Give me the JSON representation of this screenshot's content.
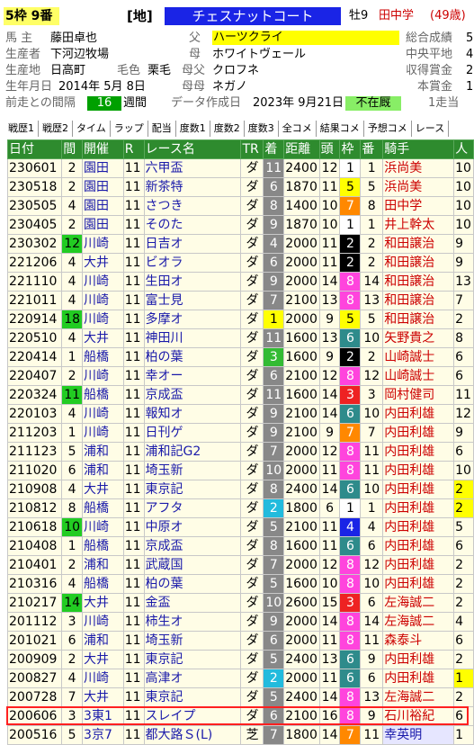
{
  "header": {
    "waku_badge": "5枠 9番",
    "course": "[地]",
    "horse_name": "チェスナットコート",
    "sex_age": "牡9",
    "trainer": "田中学",
    "trainer_age": "(49歳)",
    "rows": [
      {
        "l1": "馬 主",
        "v1": "藤田卓也",
        "l2": "父",
        "v2": "ハーツクライ",
        "l3": "総合成績",
        "v3": "5"
      },
      {
        "l1": "生産者",
        "v1": "下河辺牧場",
        "l2": "母",
        "v2": "ホワイトヴェール",
        "l3": "中央平地",
        "v3": "4"
      },
      {
        "l1": "生産地",
        "v1": "日高町",
        "l1b": "毛色",
        "v1b": "栗毛",
        "l2": "母父",
        "v2": "クロフネ",
        "l3": "収得賞金",
        "v3": "2"
      },
      {
        "l1": "生年月日",
        "v1": "2014年 5月 8日",
        "l2": "母母",
        "v2": "ネガノ",
        "l3": "本賞金",
        "v3": "1"
      },
      {
        "l1": "前走との間隔",
        "v1": "16",
        "v1u": "週間",
        "l2": "データ作成日",
        "v2": "2023年 9月21日",
        "v2b": "不在厩",
        "l3": "1走当",
        "v3": ""
      }
    ]
  },
  "tabs": [
    "戦歴1",
    "戦歴2",
    "タイム",
    "ラップ",
    "配当",
    "度数1",
    "度数2",
    "度数3",
    "全コメ",
    "結果コメ",
    "予想コメ",
    "レース"
  ],
  "colors": {
    "header_green": "#2e8b2e",
    "row_bg": "#fffde6",
    "jockey_red": "#cc0000",
    "link_blue": "#1a1aaa",
    "highlight_frame": "#ff2020"
  },
  "table": {
    "headers": [
      "日付",
      "間",
      "開催",
      "R",
      "レース名",
      "TR",
      "着",
      "距離",
      "頭",
      "枠",
      "番",
      "騎手",
      "人"
    ],
    "rows": [
      {
        "date": "230601",
        "int": "2",
        "int_color": "",
        "place": "園田",
        "r": "11",
        "race": "六甲盃",
        "tr": "ダ",
        "cha": "11",
        "cha_bg": "#888888",
        "dist": "2400",
        "n": "12",
        "waku": "1",
        "waku_bg": "#ffffff",
        "waku_fg": "#000",
        "ban": "1",
        "jockey": "浜尚美",
        "jblue": false,
        "ninki": "10",
        "ninki_bg": ""
      },
      {
        "date": "230518",
        "int": "2",
        "int_color": "",
        "place": "園田",
        "r": "11",
        "race": "新茶特",
        "tr": "ダ",
        "cha": "6",
        "cha_bg": "#888888",
        "dist": "1870",
        "n": "11",
        "waku": "5",
        "waku_bg": "#ffff00",
        "waku_fg": "#000",
        "ban": "5",
        "jockey": "浜尚美",
        "jblue": false,
        "ninki": "10",
        "ninki_bg": ""
      },
      {
        "date": "230505",
        "int": "4",
        "int_color": "",
        "place": "園田",
        "r": "11",
        "race": "さつき",
        "tr": "ダ",
        "cha": "8",
        "cha_bg": "#888888",
        "dist": "1400",
        "n": "10",
        "waku": "7",
        "waku_bg": "#ff8800",
        "waku_fg": "#fff",
        "ban": "8",
        "jockey": "田中学",
        "jblue": false,
        "ninki": "10",
        "ninki_bg": ""
      },
      {
        "date": "230405",
        "int": "2",
        "int_color": "",
        "place": "園田",
        "r": "11",
        "race": "そのた",
        "tr": "ダ",
        "cha": "9",
        "cha_bg": "#888888",
        "dist": "1870",
        "n": "10",
        "waku": "1",
        "waku_bg": "#ffffff",
        "waku_fg": "#000",
        "ban": "1",
        "jockey": "井上幹太",
        "jblue": false,
        "ninki": "10",
        "ninki_bg": ""
      },
      {
        "date": "230302",
        "int": "12",
        "int_color": "#22cc22",
        "place": "川崎",
        "r": "11",
        "race": "日吉オ",
        "tr": "ダ",
        "cha": "4",
        "cha_bg": "#888888",
        "dist": "2000",
        "n": "11",
        "waku": "2",
        "waku_bg": "#000000",
        "waku_fg": "#fff",
        "ban": "2",
        "jockey": "和田譲治",
        "jblue": false,
        "ninki": "9",
        "ninki_bg": ""
      },
      {
        "date": "221206",
        "int": "4",
        "int_color": "",
        "place": "大井",
        "r": "11",
        "race": "ビオラ",
        "tr": "ダ",
        "cha": "6",
        "cha_bg": "#888888",
        "dist": "2000",
        "n": "11",
        "waku": "2",
        "waku_bg": "#000000",
        "waku_fg": "#fff",
        "ban": "2",
        "jockey": "和田譲治",
        "jblue": false,
        "ninki": "9",
        "ninki_bg": ""
      },
      {
        "date": "221110",
        "int": "4",
        "int_color": "",
        "place": "川崎",
        "r": "11",
        "race": "生田オ",
        "tr": "ダ",
        "cha": "9",
        "cha_bg": "#888888",
        "dist": "2000",
        "n": "14",
        "waku": "8",
        "waku_bg": "#ff44dd",
        "waku_fg": "#fff",
        "ban": "14",
        "jockey": "和田譲治",
        "jblue": false,
        "ninki": "13",
        "ninki_bg": ""
      },
      {
        "date": "221011",
        "int": "4",
        "int_color": "",
        "place": "川崎",
        "r": "11",
        "race": "富士見",
        "tr": "ダ",
        "cha": "7",
        "cha_bg": "#888888",
        "dist": "2100",
        "n": "13",
        "waku": "8",
        "waku_bg": "#ff44dd",
        "waku_fg": "#fff",
        "ban": "13",
        "jockey": "和田譲治",
        "jblue": false,
        "ninki": "7",
        "ninki_bg": ""
      },
      {
        "date": "220914",
        "int": "18",
        "int_color": "#22cc22",
        "place": "川崎",
        "r": "11",
        "race": "多摩オ",
        "tr": "ダ",
        "cha": "1",
        "cha_bg": "#ffff00",
        "dist": "2000",
        "n": "9",
        "waku": "5",
        "waku_bg": "#ffff00",
        "waku_fg": "#000",
        "ban": "5",
        "jockey": "和田譲治",
        "jblue": false,
        "ninki": "2",
        "ninki_bg": ""
      },
      {
        "date": "220510",
        "int": "4",
        "int_color": "",
        "place": "大井",
        "r": "11",
        "race": "神田川",
        "tr": "ダ",
        "cha": "11",
        "cha_bg": "#888888",
        "dist": "1600",
        "n": "13",
        "waku": "6",
        "waku_bg": "#2e8b8b",
        "waku_fg": "#fff",
        "ban": "10",
        "jockey": "矢野貴之",
        "jblue": false,
        "ninki": "8",
        "ninki_bg": ""
      },
      {
        "date": "220414",
        "int": "1",
        "int_color": "",
        "place": "船橋",
        "r": "11",
        "race": "柏の葉",
        "tr": "ダ",
        "cha": "3",
        "cha_bg": "#33bb33",
        "dist": "1600",
        "n": "9",
        "waku": "2",
        "waku_bg": "#000000",
        "waku_fg": "#fff",
        "ban": "2",
        "jockey": "山崎誠士",
        "jblue": false,
        "ninki": "6",
        "ninki_bg": ""
      },
      {
        "date": "220407",
        "int": "2",
        "int_color": "",
        "place": "川崎",
        "r": "11",
        "race": "幸オー",
        "tr": "ダ",
        "cha": "6",
        "cha_bg": "#888888",
        "dist": "2100",
        "n": "12",
        "waku": "8",
        "waku_bg": "#ff44dd",
        "waku_fg": "#fff",
        "ban": "12",
        "jockey": "山崎誠士",
        "jblue": false,
        "ninki": "6",
        "ninki_bg": ""
      },
      {
        "date": "220324",
        "int": "11",
        "int_color": "#22cc22",
        "place": "船橋",
        "r": "11",
        "race": "京成盃",
        "tr": "ダ",
        "cha": "11",
        "cha_bg": "#888888",
        "dist": "1600",
        "n": "14",
        "waku": "3",
        "waku_bg": "#ee2222",
        "waku_fg": "#fff",
        "ban": "3",
        "jockey": "岡村健司",
        "jblue": false,
        "ninki": "11",
        "ninki_bg": ""
      },
      {
        "date": "220103",
        "int": "4",
        "int_color": "",
        "place": "川崎",
        "r": "11",
        "race": "報知オ",
        "tr": "ダ",
        "cha": "9",
        "cha_bg": "#888888",
        "dist": "2100",
        "n": "14",
        "waku": "6",
        "waku_bg": "#2e8b8b",
        "waku_fg": "#fff",
        "ban": "10",
        "jockey": "内田利雄",
        "jblue": false,
        "ninki": "12",
        "ninki_bg": ""
      },
      {
        "date": "211203",
        "int": "1",
        "int_color": "",
        "place": "川崎",
        "r": "11",
        "race": "日刊ゲ",
        "tr": "ダ",
        "cha": "9",
        "cha_bg": "#888888",
        "dist": "2100",
        "n": "9",
        "waku": "7",
        "waku_bg": "#ff8800",
        "waku_fg": "#fff",
        "ban": "7",
        "jockey": "内田利雄",
        "jblue": false,
        "ninki": "9",
        "ninki_bg": ""
      },
      {
        "date": "211123",
        "int": "5",
        "int_color": "",
        "place": "浦和",
        "r": "11",
        "race": "浦和記G2",
        "tr": "ダ",
        "cha": "7",
        "cha_bg": "#888888",
        "dist": "2000",
        "n": "12",
        "waku": "8",
        "waku_bg": "#ff44dd",
        "waku_fg": "#fff",
        "ban": "11",
        "jockey": "内田利雄",
        "jblue": false,
        "ninki": "6",
        "ninki_bg": ""
      },
      {
        "date": "211020",
        "int": "6",
        "int_color": "",
        "place": "浦和",
        "r": "11",
        "race": "埼玉新",
        "tr": "ダ",
        "cha": "10",
        "cha_bg": "#888888",
        "dist": "2000",
        "n": "11",
        "waku": "8",
        "waku_bg": "#ff44dd",
        "waku_fg": "#fff",
        "ban": "11",
        "jockey": "内田利雄",
        "jblue": false,
        "ninki": "10",
        "ninki_bg": ""
      },
      {
        "date": "210908",
        "int": "4",
        "int_color": "",
        "place": "大井",
        "r": "11",
        "race": "東京記",
        "tr": "ダ",
        "cha": "8",
        "cha_bg": "#888888",
        "dist": "2400",
        "n": "14",
        "waku": "6",
        "waku_bg": "#2e8b8b",
        "waku_fg": "#fff",
        "ban": "10",
        "jockey": "内田利雄",
        "jblue": false,
        "ninki": "2",
        "ninki_bg": "#ffff00"
      },
      {
        "date": "210812",
        "int": "8",
        "int_color": "",
        "place": "船橋",
        "r": "11",
        "race": "アフタ",
        "tr": "ダ",
        "cha": "2",
        "cha_bg": "#22bbdd",
        "dist": "1800",
        "n": "6",
        "waku": "1",
        "waku_bg": "#ffffff",
        "waku_fg": "#000",
        "ban": "1",
        "jockey": "内田利雄",
        "jblue": false,
        "ninki": "2",
        "ninki_bg": "#ffff00"
      },
      {
        "date": "210618",
        "int": "10",
        "int_color": "#22cc22",
        "place": "川崎",
        "r": "11",
        "race": "中原オ",
        "tr": "ダ",
        "cha": "5",
        "cha_bg": "#888888",
        "dist": "2100",
        "n": "11",
        "waku": "4",
        "waku_bg": "#1a24e6",
        "waku_fg": "#fff",
        "ban": "4",
        "jockey": "内田利雄",
        "jblue": false,
        "ninki": "5",
        "ninki_bg": ""
      },
      {
        "date": "210408",
        "int": "1",
        "int_color": "",
        "place": "船橋",
        "r": "11",
        "race": "京成盃",
        "tr": "ダ",
        "cha": "8",
        "cha_bg": "#888888",
        "dist": "1600",
        "n": "11",
        "waku": "6",
        "waku_bg": "#2e8b8b",
        "waku_fg": "#fff",
        "ban": "6",
        "jockey": "内田利雄",
        "jblue": false,
        "ninki": "6",
        "ninki_bg": ""
      },
      {
        "date": "210401",
        "int": "2",
        "int_color": "",
        "place": "浦和",
        "r": "11",
        "race": "武蔵国",
        "tr": "ダ",
        "cha": "7",
        "cha_bg": "#888888",
        "dist": "2000",
        "n": "12",
        "waku": "8",
        "waku_bg": "#ff44dd",
        "waku_fg": "#fff",
        "ban": "12",
        "jockey": "内田利雄",
        "jblue": false,
        "ninki": "2",
        "ninki_bg": ""
      },
      {
        "date": "210316",
        "int": "4",
        "int_color": "",
        "place": "船橋",
        "r": "11",
        "race": "柏の葉",
        "tr": "ダ",
        "cha": "5",
        "cha_bg": "#888888",
        "dist": "1600",
        "n": "10",
        "waku": "8",
        "waku_bg": "#ff44dd",
        "waku_fg": "#fff",
        "ban": "10",
        "jockey": "内田利雄",
        "jblue": false,
        "ninki": "2",
        "ninki_bg": ""
      },
      {
        "date": "210217",
        "int": "14",
        "int_color": "#22cc22",
        "place": "大井",
        "r": "11",
        "race": "金盃",
        "tr": "ダ",
        "cha": "10",
        "cha_bg": "#888888",
        "dist": "2600",
        "n": "15",
        "waku": "3",
        "waku_bg": "#ee2222",
        "waku_fg": "#fff",
        "ban": "6",
        "jockey": "左海誠二",
        "jblue": false,
        "ninki": "2",
        "ninki_bg": ""
      },
      {
        "date": "201112",
        "int": "3",
        "int_color": "",
        "place": "川崎",
        "r": "11",
        "race": "柿生オ",
        "tr": "ダ",
        "cha": "9",
        "cha_bg": "#888888",
        "dist": "2000",
        "n": "14",
        "waku": "8",
        "waku_bg": "#ff44dd",
        "waku_fg": "#fff",
        "ban": "14",
        "jockey": "左海誠二",
        "jblue": false,
        "ninki": "4",
        "ninki_bg": ""
      },
      {
        "date": "201021",
        "int": "6",
        "int_color": "",
        "place": "浦和",
        "r": "11",
        "race": "埼玉新",
        "tr": "ダ",
        "cha": "6",
        "cha_bg": "#888888",
        "dist": "2000",
        "n": "11",
        "waku": "8",
        "waku_bg": "#ff44dd",
        "waku_fg": "#fff",
        "ban": "11",
        "jockey": "森泰斗",
        "jblue": false,
        "ninki": "6",
        "ninki_bg": ""
      },
      {
        "date": "200909",
        "int": "2",
        "int_color": "",
        "place": "大井",
        "r": "11",
        "race": "東京記",
        "tr": "ダ",
        "cha": "5",
        "cha_bg": "#888888",
        "dist": "2400",
        "n": "13",
        "waku": "6",
        "waku_bg": "#2e8b8b",
        "waku_fg": "#fff",
        "ban": "9",
        "jockey": "内田利雄",
        "jblue": false,
        "ninki": "2",
        "ninki_bg": ""
      },
      {
        "date": "200827",
        "int": "4",
        "int_color": "",
        "place": "川崎",
        "r": "11",
        "race": "高津オ",
        "tr": "ダ",
        "cha": "2",
        "cha_bg": "#22bbdd",
        "dist": "2000",
        "n": "11",
        "waku": "6",
        "waku_bg": "#2e8b8b",
        "waku_fg": "#fff",
        "ban": "6",
        "jockey": "内田利雄",
        "jblue": false,
        "ninki": "1",
        "ninki_bg": "#ffff00"
      },
      {
        "date": "200728",
        "int": "7",
        "int_color": "",
        "place": "大井",
        "r": "11",
        "race": "東京記",
        "tr": "ダ",
        "cha": "5",
        "cha_bg": "#888888",
        "dist": "2400",
        "n": "14",
        "waku": "8",
        "waku_bg": "#ff44dd",
        "waku_fg": "#fff",
        "ban": "13",
        "jockey": "左海誠二",
        "jblue": false,
        "ninki": "2",
        "ninki_bg": ""
      },
      {
        "date": "200606",
        "int": "3",
        "int_color": "",
        "place": "3東1",
        "r": "11",
        "race": "スレイプ",
        "tr": "ダ",
        "cha": "6",
        "cha_bg": "#888888",
        "dist": "2100",
        "n": "16",
        "waku": "8",
        "waku_bg": "#ff44dd",
        "waku_fg": "#fff",
        "ban": "9",
        "jockey": "石川裕紀",
        "jblue": false,
        "ninki": "6",
        "ninki_bg": ""
      },
      {
        "date": "200516",
        "int": "5",
        "int_color": "",
        "place": "3京7",
        "r": "11",
        "race": "都大路Ｓ(L)",
        "tr": "芝",
        "cha": "7",
        "cha_bg": "#888888",
        "dist": "1800",
        "n": "14",
        "waku": "7",
        "waku_bg": "#ff8800",
        "waku_fg": "#fff",
        "ban": "11",
        "jockey": "幸英明",
        "jblue": true,
        "ninki": "1",
        "ninki_bg": ""
      }
    ]
  }
}
